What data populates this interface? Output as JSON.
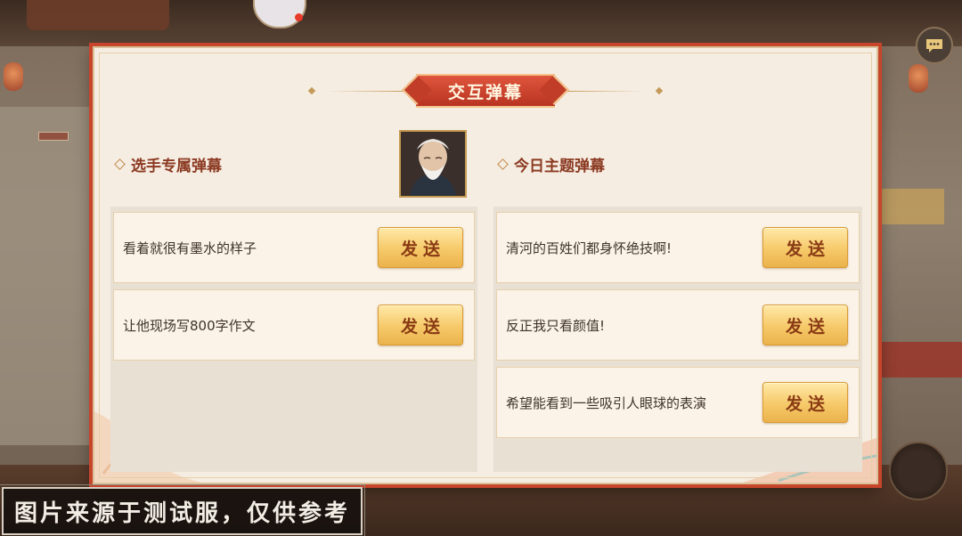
{
  "dialog": {
    "title": "交互弹幕",
    "left_section_title": "选手专属弹幕",
    "right_section_title": "今日主题弹幕",
    "player_messages": [
      {
        "text": "看着就很有墨水的样子",
        "button": "发送"
      },
      {
        "text": "让他现场写800字作文",
        "button": "发送"
      }
    ],
    "theme_messages": [
      {
        "text": "清河的百姓们都身怀绝技啊!",
        "button": "发送"
      },
      {
        "text": "反正我只看颜值!",
        "button": "发送"
      },
      {
        "text": "希望能看到一些吸引人眼球的表演",
        "button": "发送"
      }
    ]
  },
  "watermark": "图片来源于测试服，仅供参考",
  "colors": {
    "title_bg": "#c8402a",
    "section_title": "#8b3a22",
    "send_button": "#f6c969",
    "send_text": "#8a3b14",
    "dialog_bg": "#f6ede2"
  }
}
